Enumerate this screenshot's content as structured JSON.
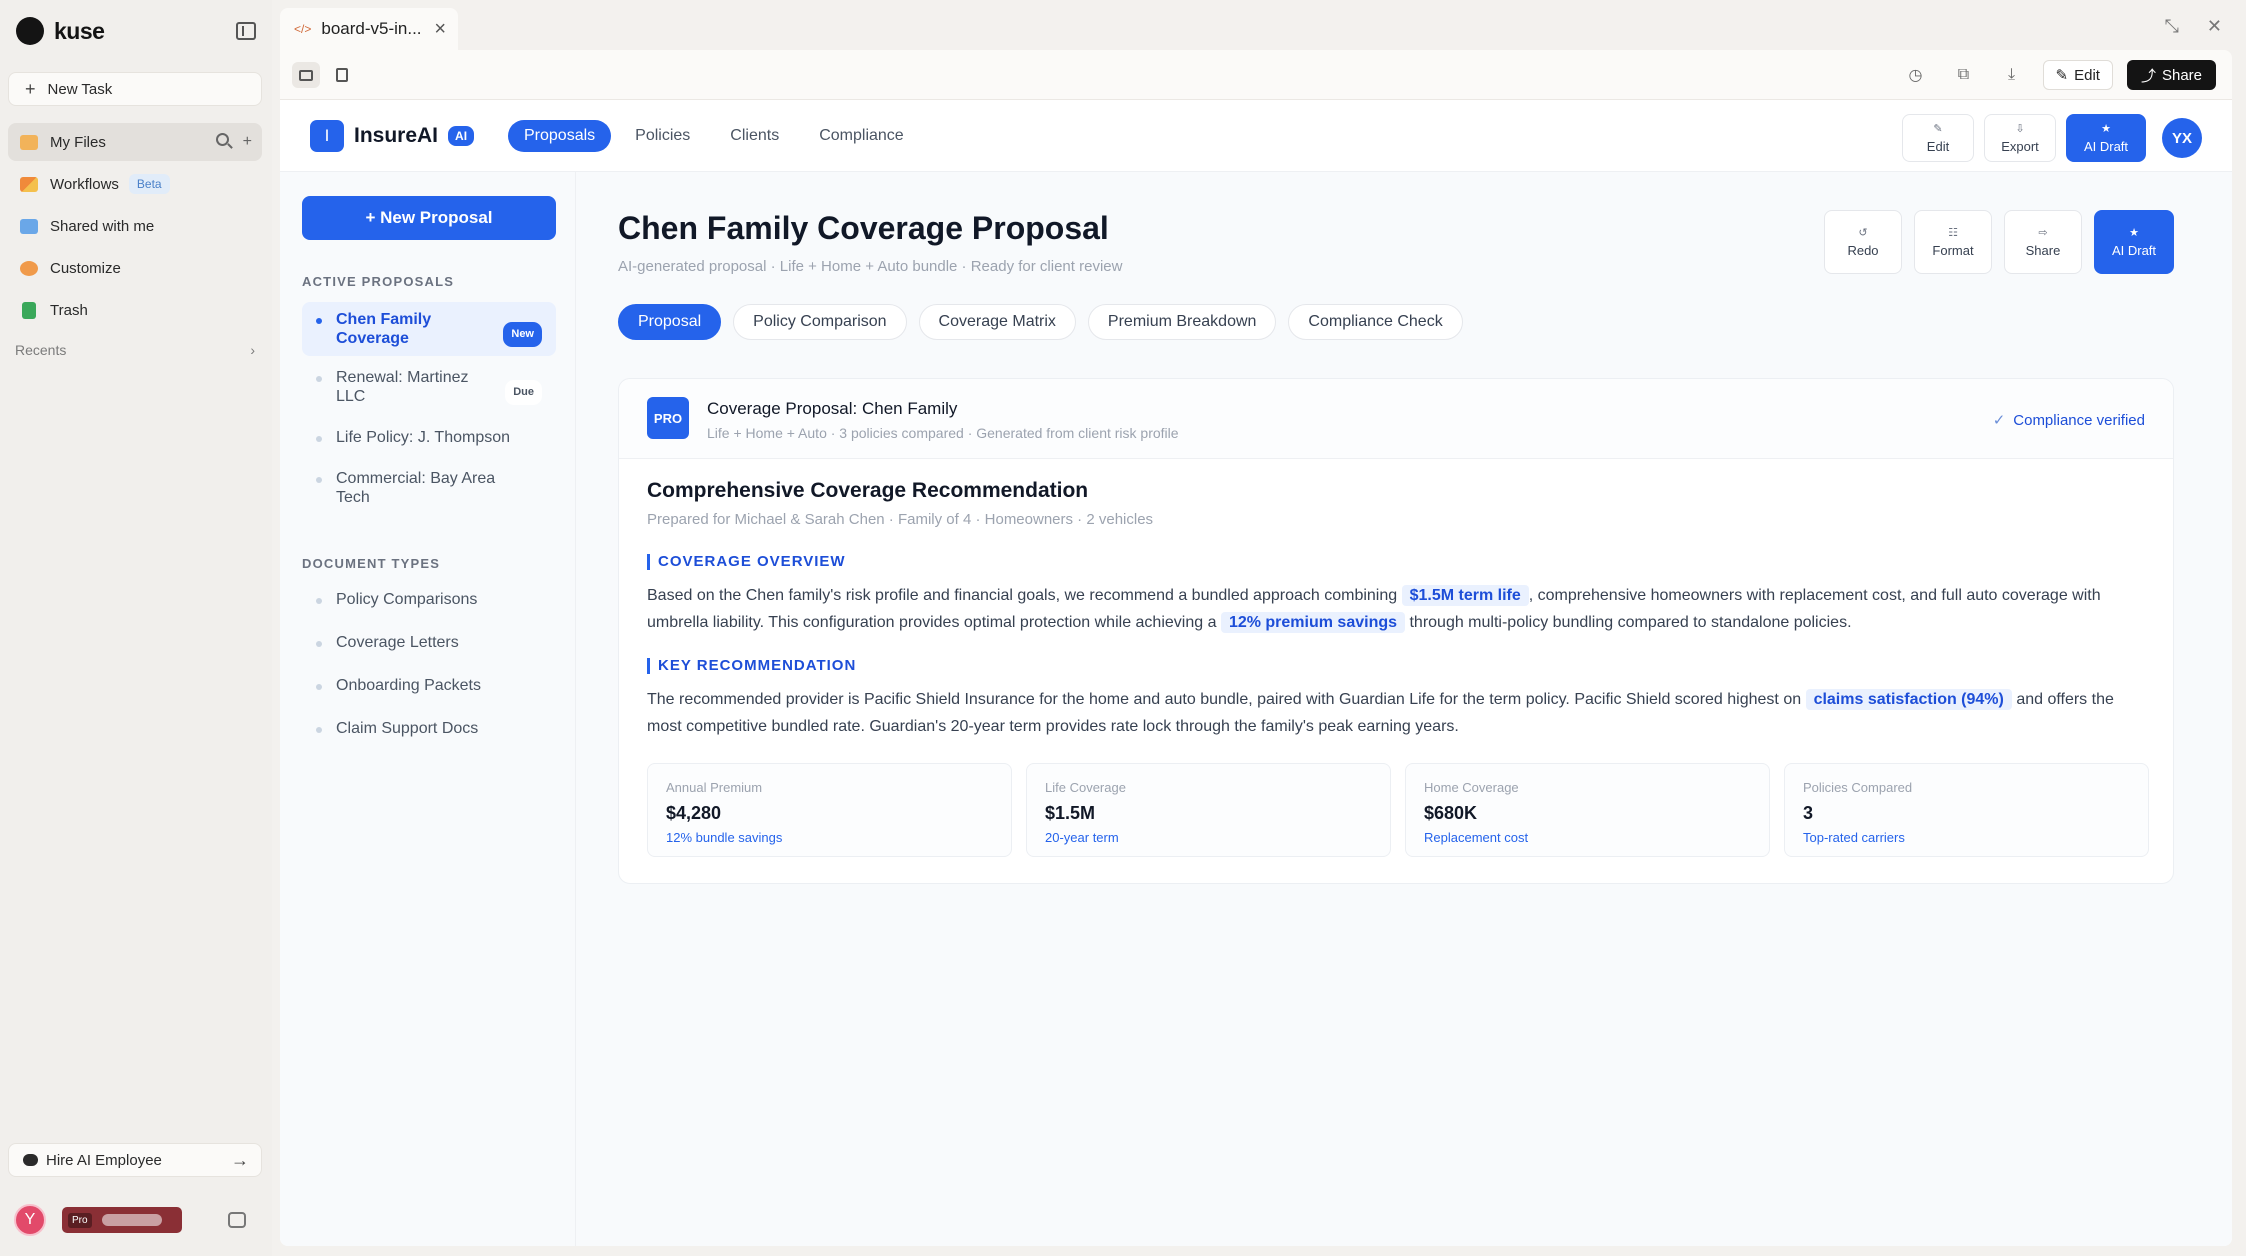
{
  "rail": {
    "logo": "kuse",
    "new_task": "New Task",
    "items": [
      {
        "label": "My Files"
      },
      {
        "label": "Workflows",
        "badge": "Beta"
      },
      {
        "label": "Shared with me"
      },
      {
        "label": "Customize"
      },
      {
        "label": "Trash"
      }
    ],
    "recents": "Recents",
    "hire": "Hire AI Employee",
    "user_initial": "Y",
    "plan": "Pro"
  },
  "browser": {
    "tab_title": "board-v5-in...",
    "edit": "Edit",
    "share": "Share"
  },
  "app": {
    "brand_initial": "I",
    "brand_name": "InsureAI",
    "brand_badge": "AI",
    "nav": [
      "Proposals",
      "Policies",
      "Clients",
      "Compliance"
    ],
    "header_actions": [
      {
        "label": "Edit",
        "icon": "✎"
      },
      {
        "label": "Export",
        "icon": "⇩"
      },
      {
        "label": "AI Draft",
        "icon": "★"
      }
    ],
    "avatar": "YX"
  },
  "sidebar": {
    "new_button": "+ New Proposal",
    "active_title": "ACTIVE PROPOSALS",
    "active": [
      {
        "label": "Chen Family Coverage",
        "badge": "New"
      },
      {
        "label": "Renewal: Martinez LLC",
        "badge": "Due"
      },
      {
        "label": "Life Policy: J. Thompson"
      },
      {
        "label": "Commercial: Bay Area Tech"
      }
    ],
    "types_title": "DOCUMENT TYPES",
    "types": [
      "Policy Comparisons",
      "Coverage Letters",
      "Onboarding Packets",
      "Claim Support Docs"
    ]
  },
  "main": {
    "title": "Chen Family Coverage Proposal",
    "subtitle": "AI-generated proposal · Life + Home + Auto bundle · Ready for client review",
    "actions": [
      {
        "label": "Redo",
        "icon": "↺"
      },
      {
        "label": "Format",
        "icon": "☷"
      },
      {
        "label": "Share",
        "icon": "⇨"
      },
      {
        "label": "AI Draft",
        "icon": "★"
      }
    ],
    "tabs": [
      "Proposal",
      "Policy Comparison",
      "Coverage Matrix",
      "Premium Breakdown",
      "Compliance Check"
    ],
    "card": {
      "badge": "PRO",
      "title": "Coverage Proposal: Chen Family",
      "subtitle": "Life + Home + Auto · 3 policies compared · Generated from client risk profile",
      "verified": "Compliance verified",
      "rec_title": "Comprehensive Coverage Recommendation",
      "rec_sub": "Prepared for Michael & Sarah Chen · Family of 4 · Homeowners · 2 vehicles",
      "overview_h": "COVERAGE OVERVIEW",
      "overview": {
        "p1": "Based on the Chen family's risk profile and financial goals, we recommend a bundled approach combining",
        "h1": "$1.5M term life",
        "p2": ", comprehensive homeowners with replacement cost, and full auto coverage with umbrella liability. This configuration provides optimal protection while achieving a",
        "h2": "12% premium savings",
        "p3": "through multi-policy bundling compared to standalone policies."
      },
      "key_h": "KEY RECOMMENDATION",
      "key": {
        "p1": "The recommended provider is Pacific Shield Insurance for the home and auto bundle, paired with Guardian Life for the term policy. Pacific Shield scored highest on",
        "h1": "claims satisfaction (94%)",
        "p2": "and offers the most competitive bundled rate. Guardian's 20-year term provides rate lock through the family's peak earning years."
      },
      "metrics": [
        {
          "label": "Annual Premium",
          "value": "$4,280",
          "note": "12% bundle savings"
        },
        {
          "label": "Life Coverage",
          "value": "$1.5M",
          "note": "20-year term"
        },
        {
          "label": "Home Coverage",
          "value": "$680K",
          "note": "Replacement cost"
        },
        {
          "label": "Policies Compared",
          "value": "3",
          "note": "Top-rated carriers"
        }
      ]
    }
  }
}
